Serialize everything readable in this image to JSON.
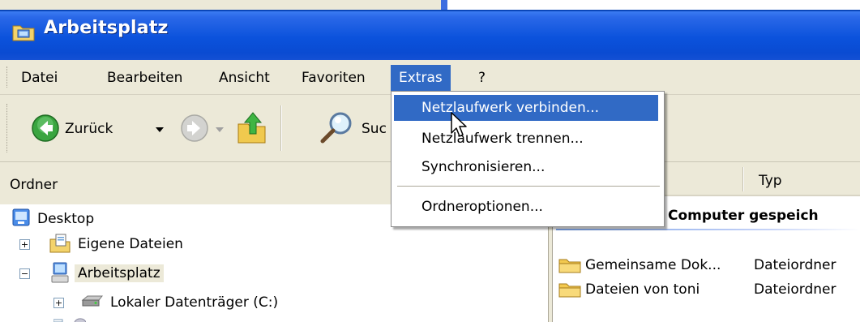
{
  "window": {
    "title": "Arbeitsplatz"
  },
  "menubar": {
    "items": [
      "Datei",
      "Bearbeiten",
      "Ansicht",
      "Favoriten",
      "Extras",
      "?"
    ],
    "active": "Extras"
  },
  "toolbar": {
    "back_label": "Zurück",
    "search_label_partial": "Suc"
  },
  "extras_menu": {
    "items": [
      {
        "label": "Netzlaufwerk verbinden...",
        "highlighted": true
      },
      {
        "label": "Netzlaufwerk trennen...",
        "highlighted": false
      },
      {
        "label": "Synchronisieren...",
        "highlighted": false
      },
      {
        "label": "Ordneroptionen...",
        "highlighted": false
      }
    ]
  },
  "folder_pane": {
    "header": "Ordner",
    "tree": [
      {
        "label": "Desktop",
        "icon": "desktop-icon"
      },
      {
        "label": "Eigene Dateien",
        "icon": "my-documents-icon",
        "expander": "+"
      },
      {
        "label": "Arbeitsplatz",
        "icon": "my-computer-icon",
        "expander": "−",
        "selected": true
      },
      {
        "label": "Lokaler Datenträger (C:)",
        "icon": "hard-drive-icon",
        "expander": "+"
      }
    ]
  },
  "file_pane": {
    "column_typ": "Typ",
    "group_header": "n Computer gespeich",
    "files": [
      {
        "name": "Gemeinsame Dok...",
        "type": "Dateiordner"
      },
      {
        "name": "Dateien von toni",
        "type": "Dateiordner"
      }
    ]
  },
  "colors": {
    "title_bar": "#0b52dc",
    "menu_highlight": "#316ac5",
    "chrome": "#ece9d8"
  }
}
